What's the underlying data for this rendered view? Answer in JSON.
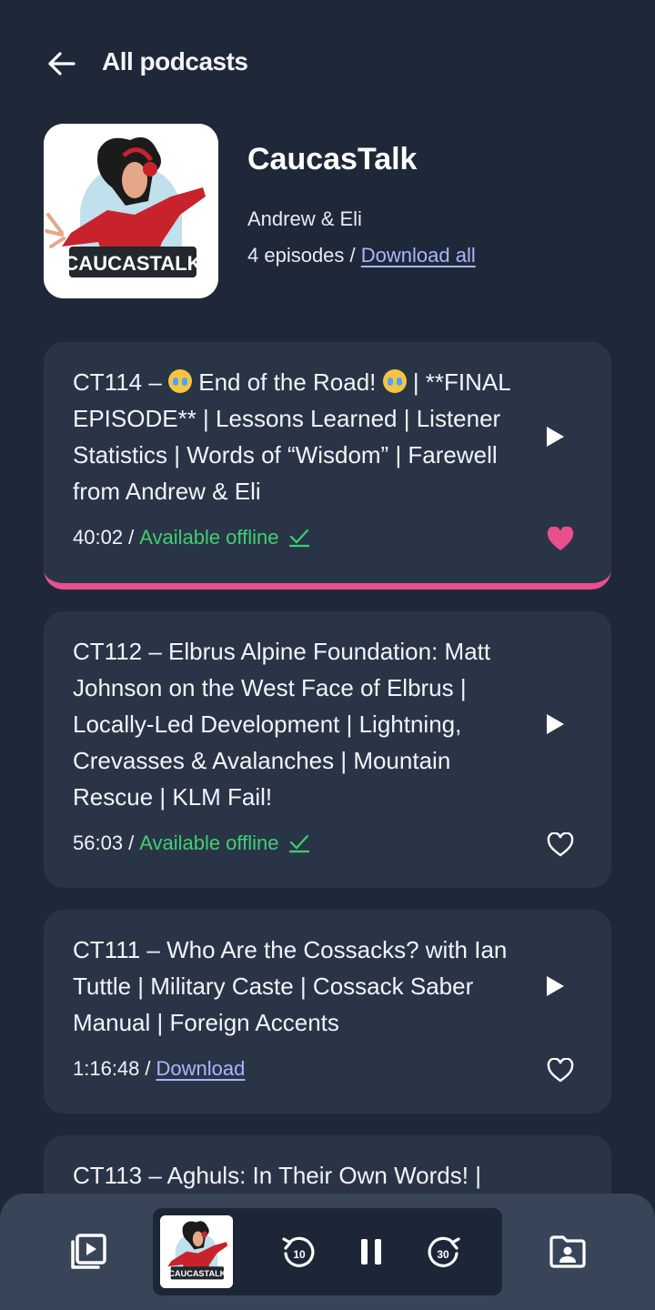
{
  "header": {
    "title": "All podcasts"
  },
  "podcast": {
    "title": "CaucasTalk",
    "authors": "Andrew & Eli",
    "episode_count": "4 episodes",
    "separator": " / ",
    "download_all": "Download all",
    "cover_text": "CAUCASTALK"
  },
  "episodes": [
    {
      "title_part1": "CT114 – ",
      "title_mid": " End of the Road! ",
      "title_part2": " | **FINAL EPISODE** | Lessons Learned | Listener Statistics | Words of “Wisdom” | Farewell from Andrew & Eli",
      "duration": "40:02",
      "status": "Available offline",
      "liked": true
    },
    {
      "title": "CT112 – Elbrus Alpine Foundation: Matt Johnson on the West Face of Elbrus | Locally-Led Development | Lightning, Crevasses & Avalanches | Mountain Rescue | KLM Fail!",
      "duration": "56:03",
      "status": "Available offline",
      "liked": false
    },
    {
      "title": "CT111 – Who Are the Cossacks? with Ian Tuttle | Military Caste | Cossack Saber Manual | Foreign Accents",
      "duration": "1:16:48",
      "status": "Download",
      "liked": false
    },
    {
      "title": "CT113 – Aghuls: In Their Own Words! |"
    }
  ],
  "player": {
    "rewind_seconds": "10",
    "forward_seconds": "30"
  },
  "colors": {
    "background": "#1f2838",
    "card": "#2a3447",
    "accent_pink": "#e8508d",
    "offline_green": "#3fcf72",
    "link": "#a7b7ff"
  }
}
